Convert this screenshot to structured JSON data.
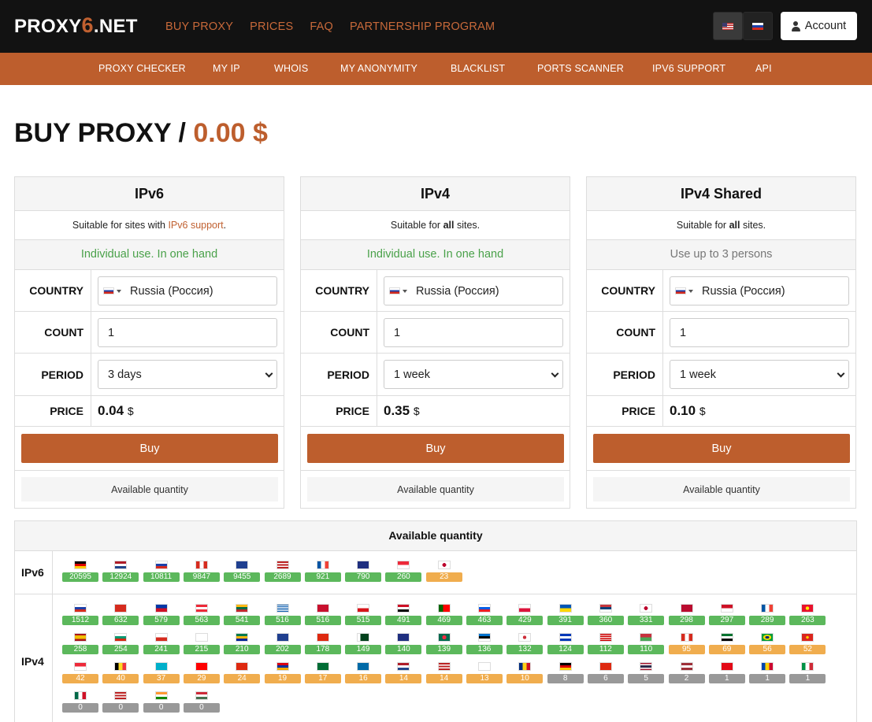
{
  "header": {
    "logo_text": "PROXY",
    "logo_six": "6",
    "logo_suffix": ".NET",
    "nav": [
      "BUY PROXY",
      "PRICES",
      "FAQ",
      "PARTNERSHIP PROGRAM"
    ],
    "account_label": "Account"
  },
  "subnav": [
    "PROXY CHECKER",
    "MY IP",
    "WHOIS",
    "MY ANONYMITY",
    "BLACKLIST",
    "PORTS SCANNER",
    "IPV6 SUPPORT",
    "API"
  ],
  "page": {
    "title": "BUY PROXY",
    "separator": " / ",
    "total": "0.00 $"
  },
  "labels": {
    "country": "COUNTRY",
    "count": "COUNT",
    "period": "PERIOD",
    "price": "PRICE",
    "buy": "Buy",
    "available": "Available quantity"
  },
  "cards": [
    {
      "title": "IPv6",
      "suit_pre": "Suitable for sites with ",
      "suit_link": "IPv6 support",
      "suit_post": ".",
      "use": "Individual use. In one hand",
      "country": "Russia (Россия)",
      "count": "1",
      "period": "3 days",
      "price": "0.04",
      "currency": "$"
    },
    {
      "title": "IPv4",
      "suit_pre": "Suitable for ",
      "suit_bold": "all",
      "suit_post": " sites.",
      "use": "Individual use. In one hand",
      "country": "Russia (Россия)",
      "count": "1",
      "period": "1 week",
      "price": "0.35",
      "currency": "$"
    },
    {
      "title": "IPv4 Shared",
      "suit_pre": "Suitable for ",
      "suit_bold": "all",
      "suit_post": " sites.",
      "use": "Use up to 3 persons",
      "country": "Russia (Россия)",
      "count": "1",
      "period": "1 week",
      "price": "0.10",
      "currency": "$"
    }
  ],
  "availability": {
    "title": "Available quantity",
    "ipv6_label": "IPv6",
    "ipv4_label": "IPv4",
    "colors": {
      "green": "#5cb85c",
      "orange": "#f0ad4e",
      "gray": "#999999",
      "accent": "#bd5e2d"
    },
    "ipv6": [
      {
        "flag": "de",
        "n": "20595",
        "c": "green"
      },
      {
        "flag": "nl",
        "n": "12924",
        "c": "green"
      },
      {
        "flag": "ru",
        "n": "10811",
        "c": "green"
      },
      {
        "flag": "ca",
        "n": "9847",
        "c": "green"
      },
      {
        "flag": "gb",
        "n": "9455",
        "c": "green"
      },
      {
        "flag": "us",
        "n": "2689",
        "c": "green"
      },
      {
        "flag": "fr",
        "n": "921",
        "c": "green"
      },
      {
        "flag": "au",
        "n": "790",
        "c": "green"
      },
      {
        "flag": "sg",
        "n": "260",
        "c": "green"
      },
      {
        "flag": "jp",
        "n": "23",
        "c": "orange"
      }
    ],
    "ipv4": [
      [
        {
          "flag": "ru",
          "n": "1512",
          "c": "green"
        },
        {
          "flag": "ch",
          "n": "632",
          "c": "green"
        },
        {
          "flag": "ph",
          "n": "579",
          "c": "green"
        },
        {
          "flag": "at",
          "n": "563",
          "c": "green"
        },
        {
          "flag": "lt",
          "n": "541",
          "c": "green"
        },
        {
          "flag": "gr",
          "n": "516",
          "c": "green"
        },
        {
          "flag": "dk",
          "n": "516",
          "c": "green"
        },
        {
          "flag": "cz",
          "n": "515",
          "c": "green"
        },
        {
          "flag": "eg",
          "n": "491",
          "c": "green"
        },
        {
          "flag": "pt",
          "n": "469",
          "c": "green"
        },
        {
          "flag": "si",
          "n": "463",
          "c": "green"
        },
        {
          "flag": "pl",
          "n": "429",
          "c": "green"
        },
        {
          "flag": "ua",
          "n": "391",
          "c": "green"
        },
        {
          "flag": "rs",
          "n": "360",
          "c": "green"
        },
        {
          "flag": "jp",
          "n": "331",
          "c": "green"
        },
        {
          "flag": "no",
          "n": "298",
          "c": "green"
        },
        {
          "flag": "id",
          "n": "297",
          "c": "green"
        },
        {
          "flag": "fr",
          "n": "289",
          "c": "green"
        },
        {
          "flag": "kg",
          "n": "263",
          "c": "green"
        }
      ],
      [
        {
          "flag": "es",
          "n": "258",
          "c": "green"
        },
        {
          "flag": "bg",
          "n": "254",
          "c": "green"
        },
        {
          "flag": "cl",
          "n": "241",
          "c": "green"
        },
        {
          "flag": "fi",
          "n": "215",
          "c": "green"
        },
        {
          "flag": "za",
          "n": "210",
          "c": "green"
        },
        {
          "flag": "gb",
          "n": "202",
          "c": "green"
        },
        {
          "flag": "cn",
          "n": "178",
          "c": "green"
        },
        {
          "flag": "pk",
          "n": "149",
          "c": "green"
        },
        {
          "flag": "au",
          "n": "140",
          "c": "green"
        },
        {
          "flag": "bd",
          "n": "139",
          "c": "green"
        },
        {
          "flag": "ee",
          "n": "136",
          "c": "green"
        },
        {
          "flag": "kr",
          "n": "132",
          "c": "green"
        },
        {
          "flag": "il",
          "n": "124",
          "c": "green"
        },
        {
          "flag": "my",
          "n": "112",
          "c": "green"
        },
        {
          "flag": "by",
          "n": "110",
          "c": "green"
        },
        {
          "flag": "ca",
          "n": "95",
          "c": "orange"
        },
        {
          "flag": "ae",
          "n": "69",
          "c": "orange"
        },
        {
          "flag": "br",
          "n": "56",
          "c": "orange"
        },
        {
          "flag": "vn",
          "n": "52",
          "c": "orange"
        }
      ],
      [
        {
          "flag": "sg",
          "n": "42",
          "c": "orange"
        },
        {
          "flag": "be",
          "n": "40",
          "c": "orange"
        },
        {
          "flag": "kz",
          "n": "37",
          "c": "orange"
        },
        {
          "flag": "tw",
          "n": "29",
          "c": "orange"
        },
        {
          "flag": "hk",
          "n": "24",
          "c": "orange"
        },
        {
          "flag": "am",
          "n": "19",
          "c": "orange"
        },
        {
          "flag": "sa",
          "n": "17",
          "c": "orange"
        },
        {
          "flag": "se",
          "n": "16",
          "c": "orange"
        },
        {
          "flag": "nl",
          "n": "14",
          "c": "orange"
        },
        {
          "flag": "us",
          "n": "14",
          "c": "orange"
        },
        {
          "flag": "cy",
          "n": "13",
          "c": "orange"
        },
        {
          "flag": "ro",
          "n": "10",
          "c": "orange"
        },
        {
          "flag": "de",
          "n": "8",
          "c": "gray"
        },
        {
          "flag": "cn",
          "n": "6",
          "c": "gray"
        },
        {
          "flag": "th",
          "n": "5",
          "c": "gray"
        },
        {
          "flag": "lv",
          "n": "2",
          "c": "gray"
        },
        {
          "flag": "tr",
          "n": "1",
          "c": "gray"
        },
        {
          "flag": "md",
          "n": "1",
          "c": "gray"
        },
        {
          "flag": "it",
          "n": "1",
          "c": "gray"
        }
      ],
      [
        {
          "flag": "mx",
          "n": "0",
          "c": "gray"
        },
        {
          "flag": "us",
          "n": "0",
          "c": "gray"
        },
        {
          "flag": "in",
          "n": "0",
          "c": "gray"
        },
        {
          "flag": "hu",
          "n": "0",
          "c": "gray"
        }
      ]
    ]
  }
}
